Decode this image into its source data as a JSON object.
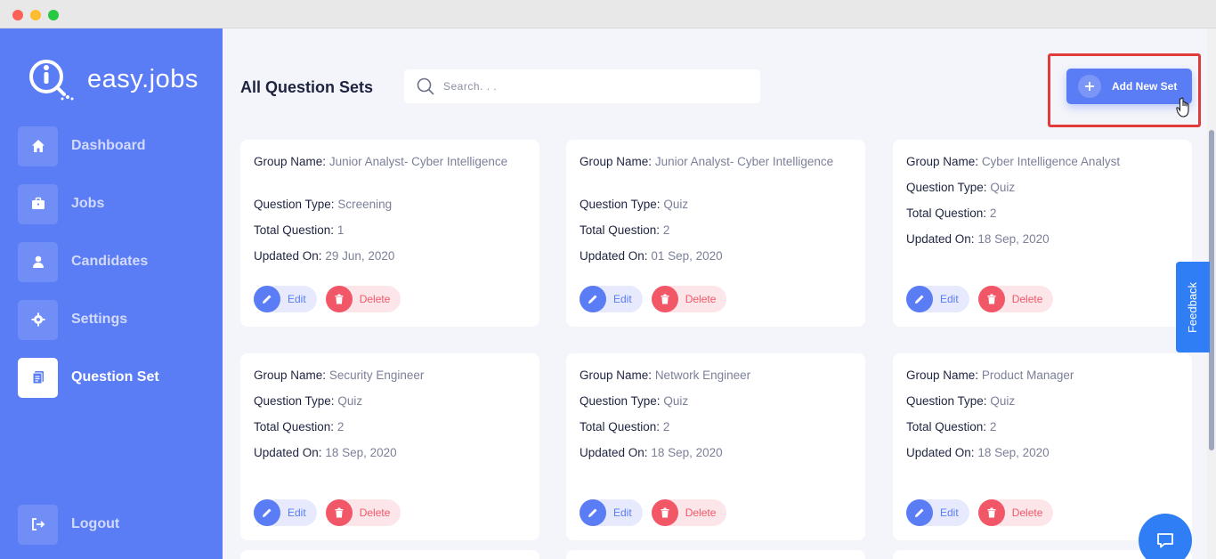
{
  "brand": {
    "name": "easy.jobs"
  },
  "sidebar": {
    "items": [
      {
        "label": "Dashboard",
        "icon": "home-icon"
      },
      {
        "label": "Jobs",
        "icon": "briefcase-icon"
      },
      {
        "label": "Candidates",
        "icon": "user-icon"
      },
      {
        "label": "Settings",
        "icon": "gear-icon"
      },
      {
        "label": "Question Set",
        "icon": "document-icon",
        "active": true
      }
    ],
    "logout": {
      "label": "Logout",
      "icon": "logout-icon"
    }
  },
  "header": {
    "title": "All Question Sets",
    "search_placeholder": "Search. . .",
    "add_button": "Add New Set"
  },
  "field_labels": {
    "group": "Group Name:",
    "type": "Question Type:",
    "total": "Total Question:",
    "updated": "Updated On:"
  },
  "actions": {
    "edit": "Edit",
    "delete": "Delete"
  },
  "cards": [
    {
      "group": "Junior Analyst- Cyber Intelligence",
      "type": "Screening",
      "total": "1",
      "updated": "29 Jun, 2020"
    },
    {
      "group": "Junior Analyst- Cyber Intelligence",
      "type": "Quiz",
      "total": "2",
      "updated": "01 Sep, 2020"
    },
    {
      "group": "Cyber Intelligence Analyst",
      "type": "Quiz",
      "total": "2",
      "updated": "18 Sep, 2020"
    },
    {
      "group": "Security Engineer",
      "type": "Quiz",
      "total": "2",
      "updated": "18 Sep, 2020"
    },
    {
      "group": "Network Engineer",
      "type": "Quiz",
      "total": "2",
      "updated": "18 Sep, 2020"
    },
    {
      "group": "Product Manager",
      "type": "Quiz",
      "total": "2",
      "updated": "18 Sep, 2020"
    }
  ],
  "feedback": {
    "label": "Feedback"
  },
  "colors": {
    "primary": "#5a7cf5",
    "danger": "#f25767",
    "feedback": "#2f7ef6",
    "highlight": "#e03c3c"
  }
}
